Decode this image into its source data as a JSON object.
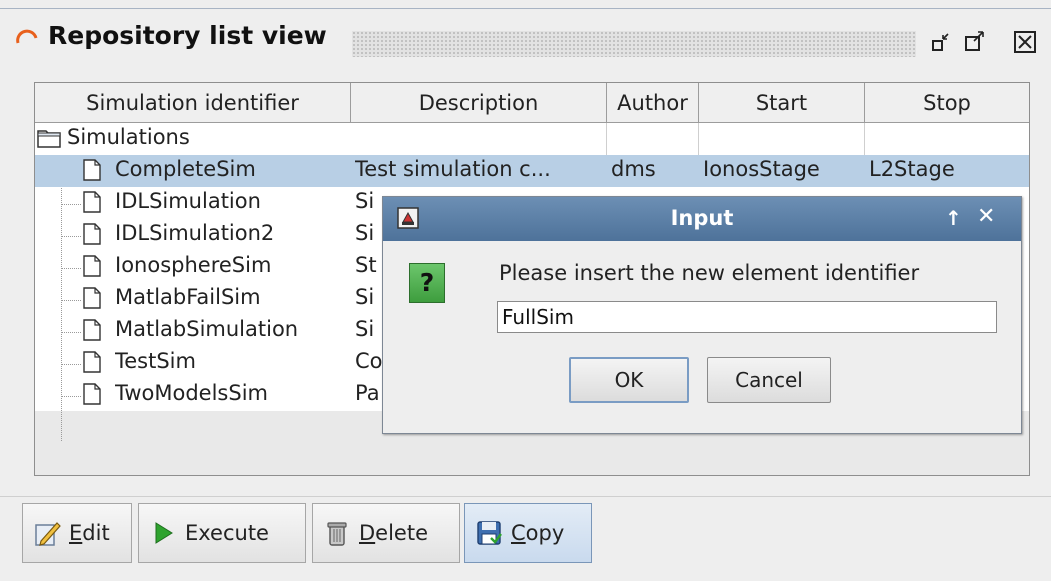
{
  "window": {
    "title": "Repository list view",
    "controls": [
      "minimize-icon",
      "maximize-icon",
      "close-icon"
    ]
  },
  "table": {
    "columns": [
      "Simulation identifier",
      "Description",
      "Author",
      "Start",
      "Stop"
    ],
    "root_label": "Simulations",
    "rows": [
      {
        "id": "CompleteSim",
        "description": "Test simulation c...",
        "author": "dms",
        "start": "IonosStage",
        "stop": "L2Stage",
        "selected": true
      },
      {
        "id": "IDLSimulation",
        "description": "Si",
        "author": "",
        "start": "",
        "stop": ""
      },
      {
        "id": "IDLSimulation2",
        "description": "Si",
        "author": "",
        "start": "",
        "stop": ""
      },
      {
        "id": "IonosphereSim",
        "description": "St",
        "author": "",
        "start": "",
        "stop": ""
      },
      {
        "id": "MatlabFailSim",
        "description": "Si",
        "author": "",
        "start": "",
        "stop": ""
      },
      {
        "id": "MatlabSimulation",
        "description": "Si",
        "author": "",
        "start": "",
        "stop": ""
      },
      {
        "id": "TestSim",
        "description": "Co",
        "author": "",
        "start": "",
        "stop": ""
      },
      {
        "id": "TwoModelsSim",
        "description": "Pa",
        "author": "",
        "start": "",
        "stop": ""
      }
    ]
  },
  "dialog": {
    "title": "Input",
    "message": "Please insert the new element identifier",
    "input_value": "FullSim",
    "ok_label": "OK",
    "cancel_label": "Cancel",
    "question_glyph": "?",
    "up_glyph": "↑",
    "close_glyph": "✕"
  },
  "toolbar": {
    "buttons": [
      {
        "label": "Edit",
        "icon": "edit-icon"
      },
      {
        "label": "Execute",
        "icon": "play-icon"
      },
      {
        "label": "Delete",
        "icon": "trash-icon"
      },
      {
        "label": "Copy",
        "icon": "save-icon",
        "active": true
      }
    ]
  },
  "colors": {
    "selection": "#b8cfe5",
    "dialog_title": "#5a7ea6",
    "question_icon": "#4caf50"
  }
}
